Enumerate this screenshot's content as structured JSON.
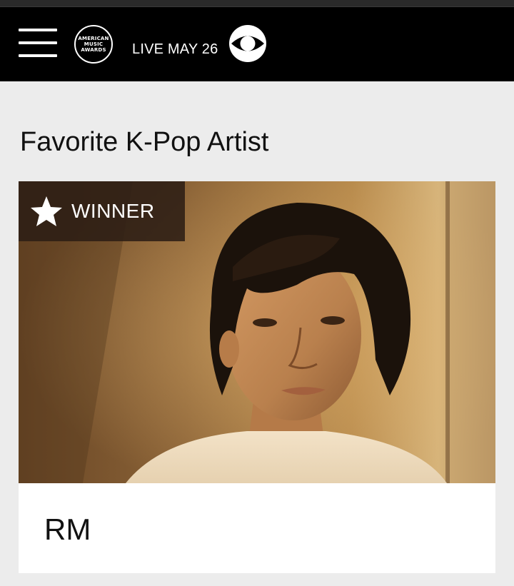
{
  "header": {
    "menu_icon": "hamburger-menu-icon",
    "logo": {
      "lines": [
        "AMERICAN",
        "MUSIC",
        "AWARDS"
      ]
    },
    "broadcast_text": "LIVE MAY 26",
    "network_icon": "cbs-eye-icon"
  },
  "category": {
    "title": "Favorite K-Pop Artist"
  },
  "winner_card": {
    "badge_icon": "star-icon",
    "badge_label": "WINNER",
    "artist_name": "RM",
    "photo_subject": "artist-photo"
  },
  "colors": {
    "navbar_bg": "#000000",
    "page_bg": "#ececec",
    "badge_bg": "#2c1e14",
    "text_primary": "#111111",
    "text_inverse": "#ffffff"
  }
}
